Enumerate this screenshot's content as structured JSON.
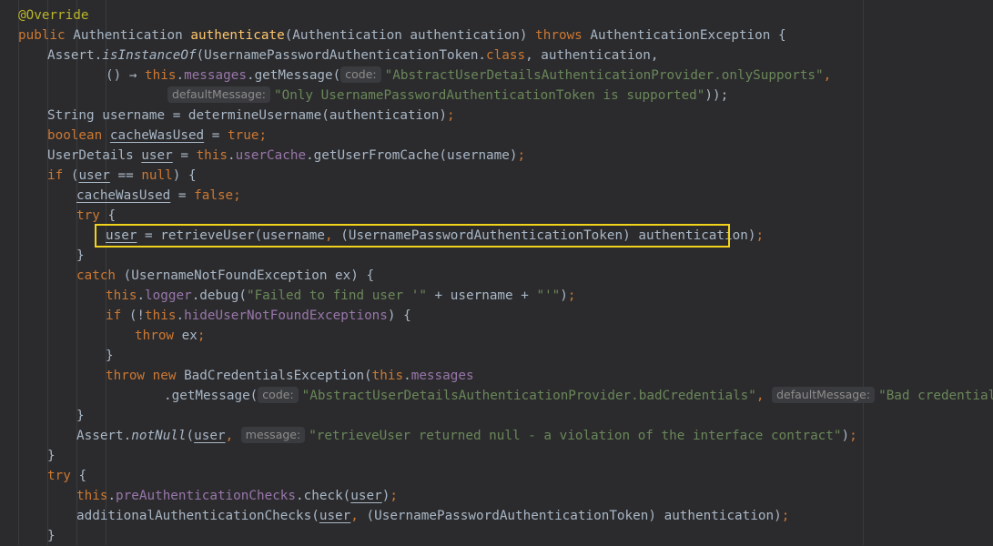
{
  "code": {
    "l1_annotation": "@Override",
    "l2_public": "public ",
    "l2_type": "Authentication ",
    "l2_method": "authenticate",
    "l2_params": "(Authentication authentication) ",
    "l2_throws": "throws ",
    "l2_rest": "AuthenticationException {",
    "l3_assert": "Assert.",
    "l3_method": "isInstanceOf",
    "l3_args": "(UsernamePasswordAuthenticationToken.",
    "l3_class": "class",
    "l3_rest": ", authentication,",
    "l4_lambda": "() → ",
    "l4_this": "this",
    "l4_dot": ".",
    "l4_messages": "messages",
    "l4_get": ".getMessage(",
    "l4_hint": "code:",
    "l4_str": "\"AbstractUserDetailsAuthenticationProvider.onlySupports\"",
    "l4_comma": ",",
    "l5_hint": "defaultMessage:",
    "l5_str": "\"Only UsernamePasswordAuthenticationToken is supported\"",
    "l5_end": "));",
    "l6_code": "String username = determineUsername(authentication)",
    "l6_semi": ";",
    "l7_kw": "boolean ",
    "l7_var": "cacheWasUsed",
    "l7_eq": " = ",
    "l7_val": "true",
    "l7_semi": ";",
    "l8_type": "UserDetails ",
    "l8_var": "user",
    "l8_eq": " = ",
    "l8_this": "this",
    "l8_dot": ".",
    "l8_field": "userCache",
    "l8_rest": ".getUserFromCache(username)",
    "l8_semi": ";",
    "l9_if": "if ",
    "l9_paren": "(",
    "l9_var": "user",
    "l9_eq": " == ",
    "l9_null": "null",
    "l9_rest": ") {",
    "l10_var": "cacheWasUsed",
    "l10_eq": " = ",
    "l10_val": "false",
    "l10_semi": ";",
    "l11_try": "try ",
    "l11_brace": "{",
    "l12_var": "user",
    "l12_rest": " = retrieveUser(username",
    "l12_comma": ",",
    "l12_rest2": " (UsernamePasswordAuthenticationToken) authentication)",
    "l12_semi": ";",
    "l13_brace": "}",
    "l14_catch": "catch ",
    "l14_rest": "(UsernameNotFoundException ex) {",
    "l15_this": "this",
    "l15_dot": ".",
    "l15_field": "logger",
    "l15_debug": ".debug(",
    "l15_str1": "\"Failed to find user '\"",
    "l15_mid": " + username + ",
    "l15_str2": "\"'\"",
    "l15_end": ")",
    "l15_semi": ";",
    "l16_if": "if ",
    "l16_paren": "(!",
    "l16_this": "this",
    "l16_dot": ".",
    "l16_field": "hideUserNotFoundExceptions",
    "l16_rest": ") {",
    "l17_throw": "throw ",
    "l17_ex": "ex",
    "l17_semi": ";",
    "l18_brace": "}",
    "l19_throw": "throw new ",
    "l19_cls": "BadCredentialsException(",
    "l19_this": "this",
    "l19_dot": ".",
    "l19_field": "messages",
    "l20_get": ".getMessage(",
    "l20_hint1": "code:",
    "l20_str1": "\"AbstractUserDetailsAuthenticationProvider.badCredentials\"",
    "l20_comma": ",",
    "l20_hint2": "defaultMessage:",
    "l20_str2": "\"Bad credentials\"",
    "l20_end": "))",
    "l20_semi": ";",
    "l21_brace": "}",
    "l22_assert": "Assert.",
    "l22_method": "notNull",
    "l22_paren": "(",
    "l22_var": "user",
    "l22_comma": ",",
    "l22_hint": "message:",
    "l22_str": "\"retrieveUser returned null - a violation of the interface contract\"",
    "l22_end": ")",
    "l22_semi": ";",
    "l23_brace": "}",
    "l24_try": "try ",
    "l24_brace": "{",
    "l25_this": "this",
    "l25_dot": ".",
    "l25_field": "preAuthenticationChecks",
    "l25_check": ".check(",
    "l25_var": "user",
    "l25_end": ")",
    "l25_semi": ";",
    "l26_call": "additionalAuthenticationChecks(",
    "l26_var": "user",
    "l26_comma": ",",
    "l26_rest": " (UsernamePasswordAuthenticationToken) authentication)",
    "l26_semi": ";",
    "l27_brace": "}"
  },
  "colors": {
    "background": "#2b2b2d",
    "keyword": "#cc7832",
    "method_decl": "#ffc66d",
    "field": "#9876aa",
    "string": "#6a8759",
    "annotation": "#bbb529",
    "highlight_box": "#f2d21a"
  }
}
